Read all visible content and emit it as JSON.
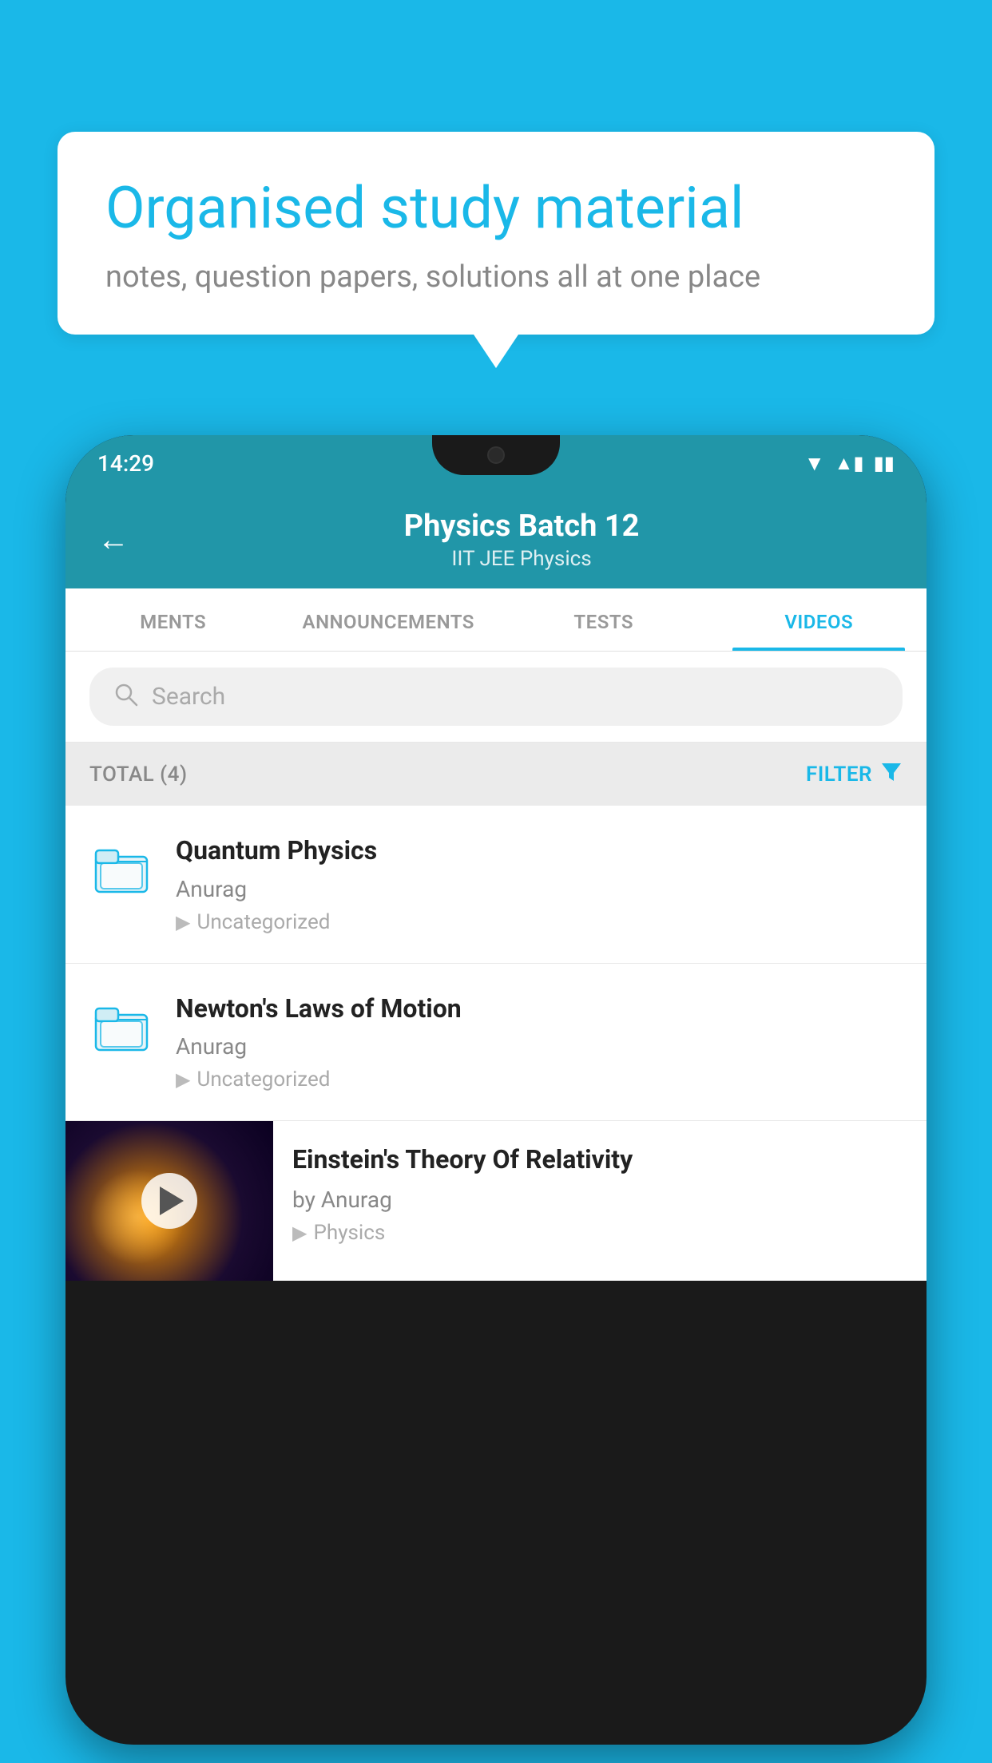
{
  "background_color": "#1ab8e8",
  "bubble": {
    "title": "Organised study material",
    "subtitle": "notes, question papers, solutions all at one place"
  },
  "phone": {
    "status_bar": {
      "time": "14:29",
      "wifi_icon": "▾",
      "signal_icon": "▲",
      "battery_icon": "▮"
    },
    "header": {
      "back_label": "←",
      "title": "Physics Batch 12",
      "subtitle": "IIT JEE   Physics"
    },
    "tabs": [
      {
        "label": "MENTS",
        "active": false
      },
      {
        "label": "ANNOUNCEMENTS",
        "active": false
      },
      {
        "label": "TESTS",
        "active": false
      },
      {
        "label": "VIDEOS",
        "active": true
      }
    ],
    "search": {
      "placeholder": "Search"
    },
    "filter_row": {
      "total_label": "TOTAL (4)",
      "filter_label": "FILTER"
    },
    "video_items": [
      {
        "title": "Quantum Physics",
        "author": "Anurag",
        "tag": "Uncategorized",
        "has_thumbnail": false
      },
      {
        "title": "Newton's Laws of Motion",
        "author": "Anurag",
        "tag": "Uncategorized",
        "has_thumbnail": false
      },
      {
        "title": "Einstein's Theory Of Relativity",
        "author": "by Anurag",
        "tag": "Physics",
        "has_thumbnail": true
      }
    ]
  }
}
